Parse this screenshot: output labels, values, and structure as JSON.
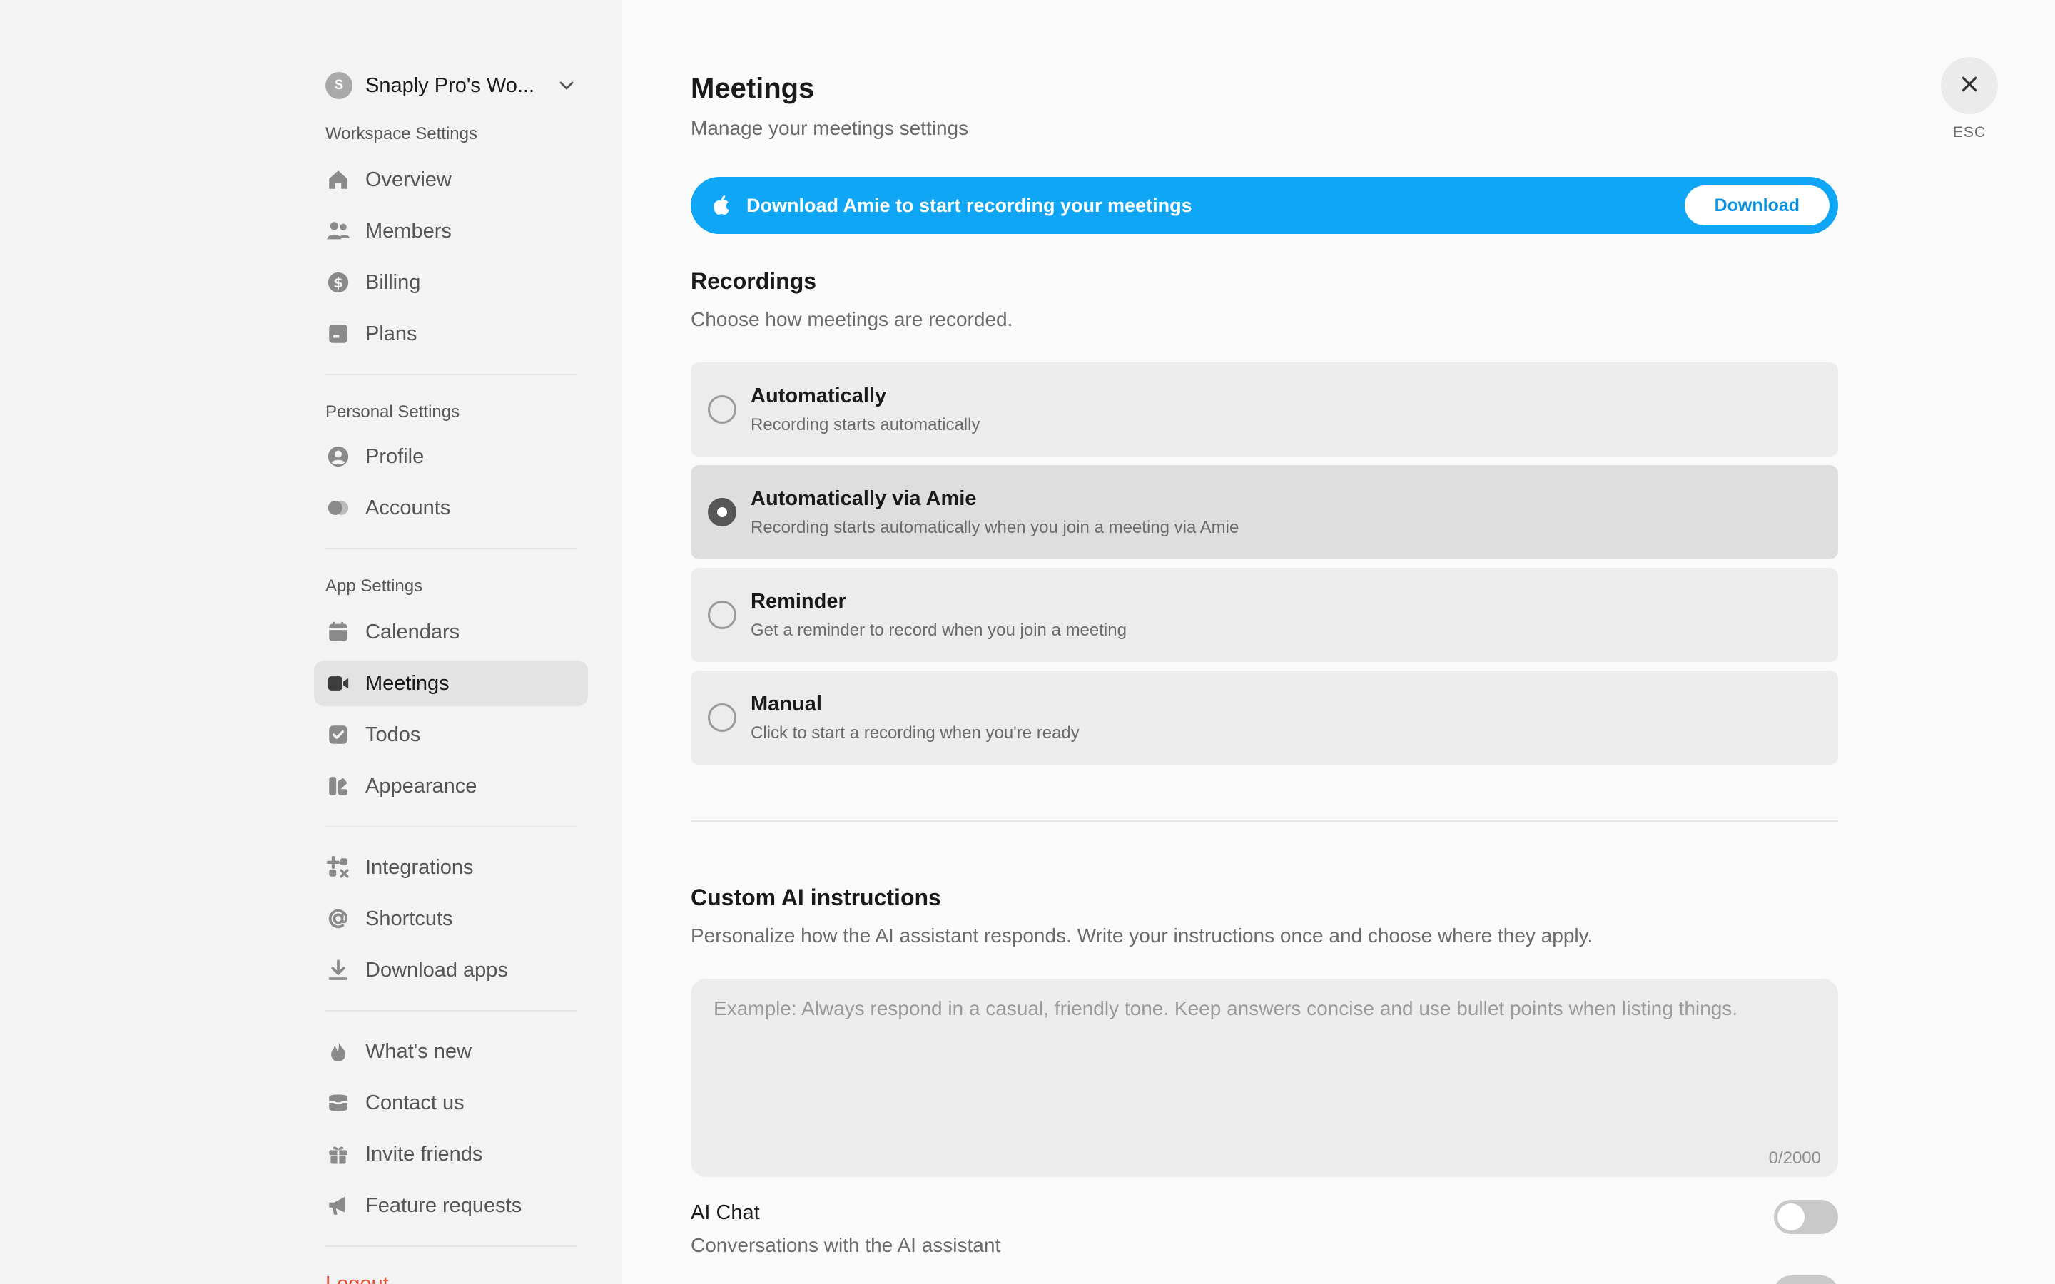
{
  "workspace": {
    "avatar_letter": "S",
    "name": "Snaply Pro's Wo..."
  },
  "sidebar": {
    "workspace_settings_label": "Workspace Settings",
    "workspace_items": [
      {
        "label": "Overview",
        "icon": "home-icon"
      },
      {
        "label": "Members",
        "icon": "members-icon"
      },
      {
        "label": "Billing",
        "icon": "dollar-icon"
      },
      {
        "label": "Plans",
        "icon": "plans-icon"
      }
    ],
    "personal_settings_label": "Personal Settings",
    "personal_items": [
      {
        "label": "Profile",
        "icon": "profile-icon"
      },
      {
        "label": "Accounts",
        "icon": "accounts-icon"
      }
    ],
    "app_settings_label": "App Settings",
    "app_items": [
      {
        "label": "Calendars",
        "icon": "calendar-icon"
      },
      {
        "label": "Meetings",
        "icon": "video-icon",
        "active": true
      },
      {
        "label": "Todos",
        "icon": "checkbox-icon"
      },
      {
        "label": "Appearance",
        "icon": "appearance-icon"
      }
    ],
    "tool_items": [
      {
        "label": "Integrations",
        "icon": "integrations-icon"
      },
      {
        "label": "Shortcuts",
        "icon": "at-icon"
      },
      {
        "label": "Download apps",
        "icon": "download-icon"
      }
    ],
    "misc_items": [
      {
        "label": "What's new",
        "icon": "flame-icon"
      },
      {
        "label": "Contact us",
        "icon": "inbox-icon"
      },
      {
        "label": "Invite friends",
        "icon": "gift-icon"
      },
      {
        "label": "Feature requests",
        "icon": "megaphone-icon"
      }
    ],
    "logout_label": "Logout"
  },
  "main": {
    "title": "Meetings",
    "subtitle": "Manage your meetings settings",
    "banner": {
      "text": "Download Amie to start recording your meetings",
      "button": "Download",
      "color": "#0ea6f5"
    },
    "recordings": {
      "title": "Recordings",
      "subtitle": "Choose how meetings are recorded.",
      "options": [
        {
          "title": "Automatically",
          "desc": "Recording starts automatically",
          "selected": false
        },
        {
          "title": "Automatically via Amie",
          "desc": "Recording starts automatically when you join a meeting via Amie",
          "selected": true
        },
        {
          "title": "Reminder",
          "desc": "Get a reminder to record when you join a meeting",
          "selected": false
        },
        {
          "title": "Manual",
          "desc": "Click to start a recording when you're ready",
          "selected": false
        }
      ]
    },
    "custom_ai": {
      "title": "Custom AI instructions",
      "subtitle": "Personalize how the AI assistant responds. Write your instructions once and choose where they apply.",
      "placeholder": "Example: Always respond in a casual, friendly tone. Keep answers concise and use bullet points when listing things.",
      "value": "",
      "char_count": "0/2000"
    },
    "ai_chat": {
      "title": "AI Chat",
      "desc": "Conversations with the AI assistant",
      "enabled": false
    }
  },
  "close": {
    "label": "ESC"
  }
}
